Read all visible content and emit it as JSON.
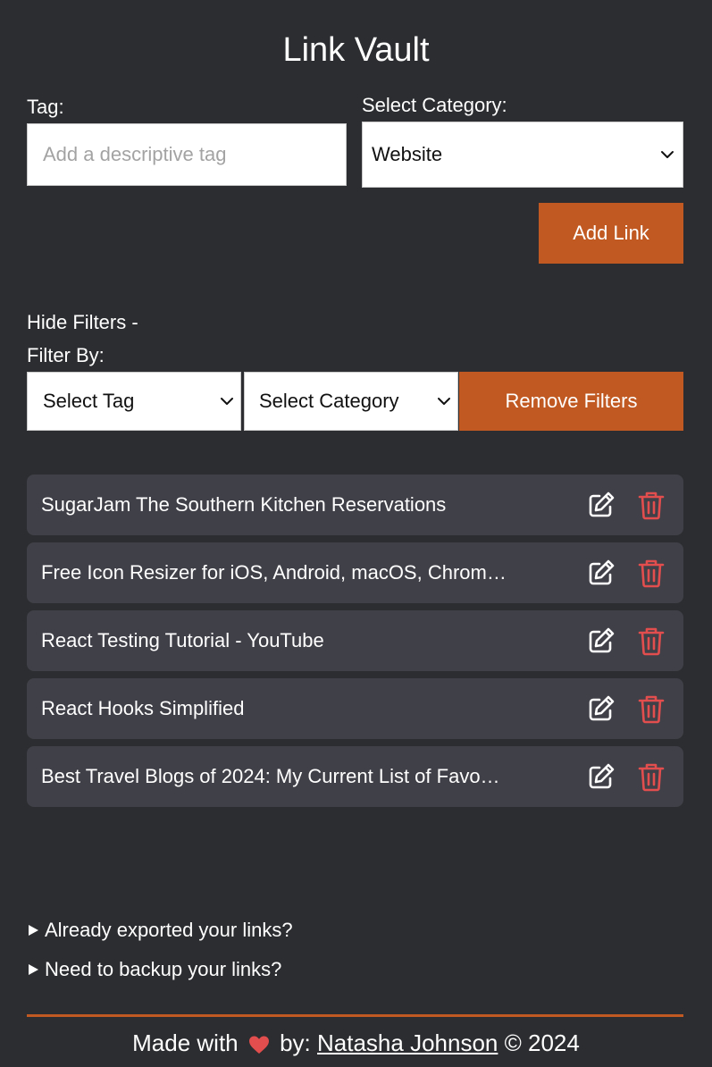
{
  "app": {
    "title": "Link Vault"
  },
  "form": {
    "tag_label": "Tag:",
    "tag_placeholder": "Add a descriptive tag",
    "category_label": "Select Category:",
    "category_value": "Website",
    "add_button": "Add Link"
  },
  "filters": {
    "toggle_label": "Hide Filters -",
    "filter_by_label": "Filter By:",
    "tag_select": "Select Tag",
    "category_select": "Select Category",
    "remove_button": "Remove Filters"
  },
  "links": [
    {
      "title": "SugarJam The Southern Kitchen Reservations"
    },
    {
      "title": "Free Icon Resizer for iOS, Android, macOS, Chrom…"
    },
    {
      "title": "React Testing Tutorial - YouTube"
    },
    {
      "title": "React Hooks Simplified"
    },
    {
      "title": "Best Travel Blogs of 2024: My Current List of Favo…"
    }
  ],
  "disclosures": {
    "exported": "Already exported your links?",
    "backup": "Need to backup your links?"
  },
  "footer": {
    "made_with": "Made with",
    "by": "by:",
    "author": "Natasha Johnson",
    "copyright": "© 2024"
  },
  "colors": {
    "background": "#2c2d30",
    "accent": "#c05a22",
    "row_background": "#404048",
    "delete_icon": "#e24d4d",
    "heart": "#e24d4d"
  },
  "icons": {
    "row_edit": "edit-icon",
    "row_delete": "trash-icon",
    "select_arrow": "chevron-down-icon",
    "disclosure": "triangle-right-icon",
    "footer_heart": "heart-icon"
  }
}
